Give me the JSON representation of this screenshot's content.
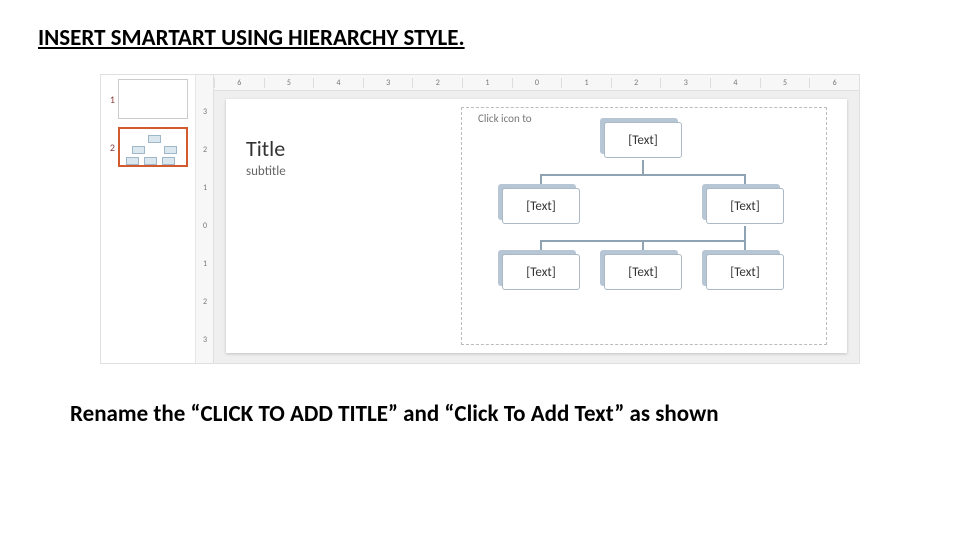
{
  "heading": "INSERT SMARTART USING HIERARCHY STYLE.",
  "caption": "Rename the “CLICK TO ADD TITLE” and “Click To Add Text” as shown",
  "thumbs": {
    "n1": "1",
    "n2": "2"
  },
  "hruler": {
    "r0": "6",
    "r1": "5",
    "r2": "4",
    "r3": "3",
    "r4": "2",
    "r5": "1",
    "r6": "0",
    "r7": "1",
    "r8": "2",
    "r9": "3",
    "r10": "4",
    "r11": "5",
    "r12": "6"
  },
  "vruler": {
    "v0": "3",
    "v1": "2",
    "v2": "1",
    "v3": "0",
    "v4": "1",
    "v5": "2",
    "v6": "3"
  },
  "slide": {
    "title": "Title",
    "subtitle": "subtitle",
    "click_icon": "Click icon to",
    "nodes": {
      "root": "[Text]",
      "l2a": "[Text]",
      "l2b": "[Text]",
      "l3a": "[Text]",
      "l3b": "[Text]",
      "l3c": "[Text]"
    }
  }
}
